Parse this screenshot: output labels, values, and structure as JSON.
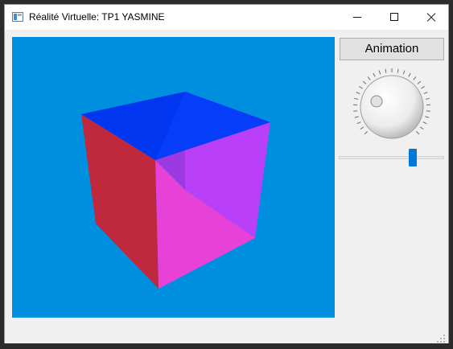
{
  "window": {
    "title": "Réalité Virtuelle: TP1 YASMINE",
    "icon": "app-window-icon",
    "controls": {
      "minimize_icon": "minimize-icon",
      "maximize_icon": "maximize-icon",
      "close_icon": "close-icon"
    }
  },
  "viewport": {
    "background_color": "#008fde",
    "object": "cube",
    "face_colors": {
      "top": "#0036f0",
      "left": "#c0283e",
      "right": "#b940f8",
      "bottom": "#e841d8"
    }
  },
  "controls": {
    "animation_button_label": "Animation",
    "dial": {
      "icon": "rotation-dial"
    },
    "slider": {
      "fraction": 0.72,
      "accent_color": "#0078d7"
    }
  }
}
